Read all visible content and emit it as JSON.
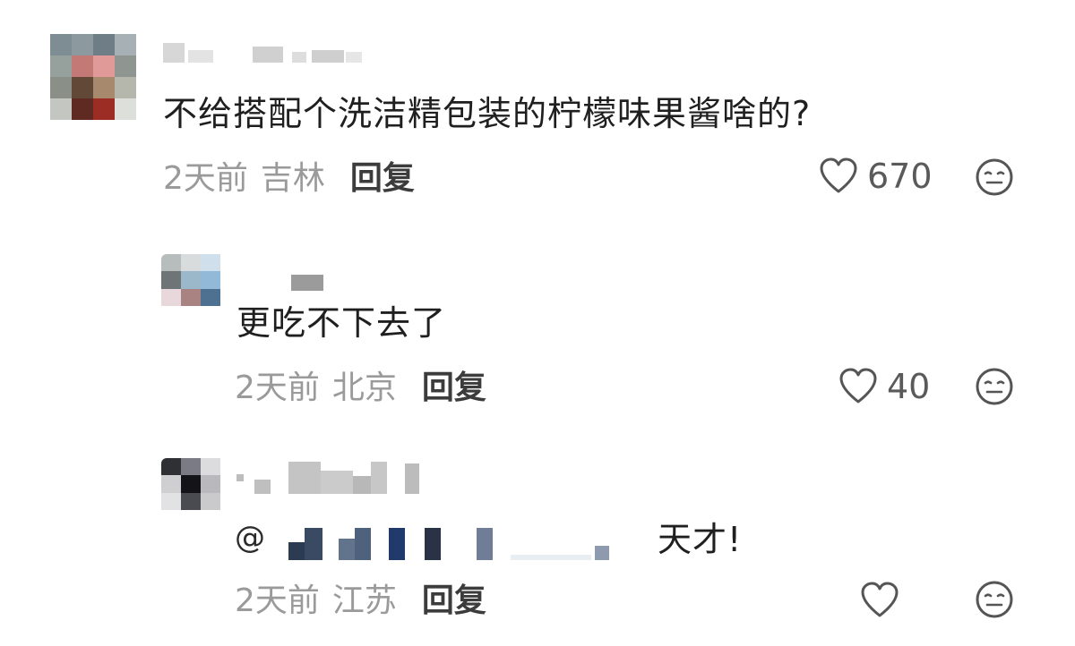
{
  "comments": [
    {
      "text": "不给搭配个洗洁精包装的柠檬味果酱啥的?",
      "time": "2天前",
      "location": "吉林",
      "reply_label": "回复",
      "like_count": "670",
      "username_masked": true
    },
    {
      "text": "更吃不下去了",
      "time": "2天前",
      "location": "北京",
      "reply_label": "回复",
      "like_count": "40",
      "username_masked": true
    },
    {
      "mention_symbol": "@",
      "text": "天才!",
      "time": "2天前",
      "location": "江苏",
      "reply_label": "回复",
      "like_count": "",
      "username_masked": true
    }
  ],
  "icons": {
    "like": "heart-outline-icon",
    "react": "neutral-face-icon"
  },
  "colors": {
    "text_primary": "#1f1f1f",
    "text_meta": "#9a9a9a",
    "reply": "#3c3c3c",
    "icon_stroke": "#555555"
  }
}
